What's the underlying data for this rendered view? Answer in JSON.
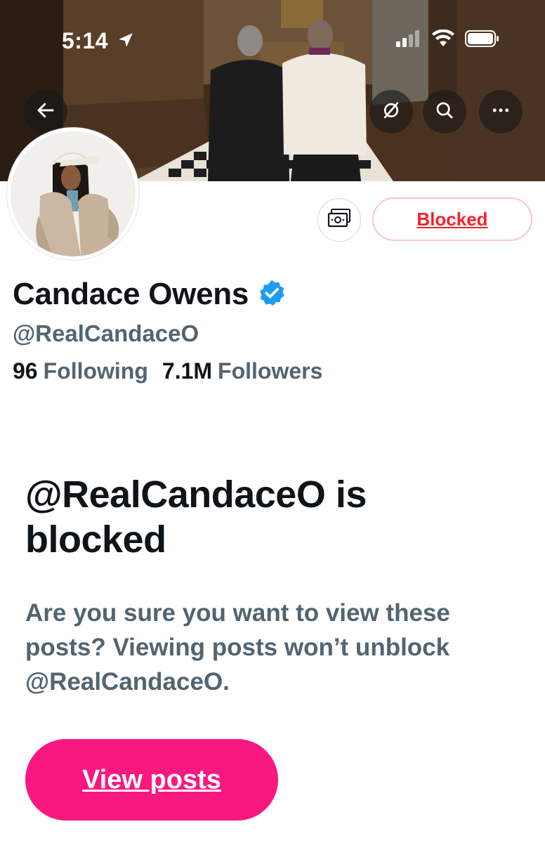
{
  "status_bar": {
    "time": "5:14",
    "icons": [
      "location-arrow-icon",
      "cellular-signal-icon",
      "wifi-icon",
      "battery-icon"
    ]
  },
  "banner": {
    "description_icons": [
      "back-arrow-icon",
      "no-signal-icon",
      "search-icon",
      "more-icon"
    ]
  },
  "profile": {
    "display_name": "Candace Owens",
    "verified": true,
    "handle": "@RealCandaceO",
    "following_count": "96",
    "following_label": "Following",
    "followers_count": "7.1M",
    "followers_label": "Followers"
  },
  "actions": {
    "tip_icon": "money-icon",
    "blocked_label": "Blocked"
  },
  "notice": {
    "title": "@RealCandaceO is blocked",
    "body": "Are you sure you want to view these posts? Viewing posts won’t unblock @RealCandaceO.",
    "button_label": "View posts"
  },
  "colors": {
    "verified_blue": "#1d9bf0",
    "blocked_red": "#f4212e",
    "view_pink": "#f91880",
    "secondary_text": "#536471"
  }
}
